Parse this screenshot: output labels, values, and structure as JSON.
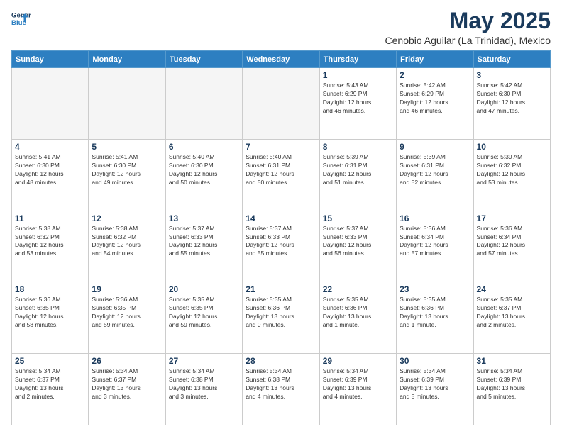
{
  "header": {
    "logo_line1": "General",
    "logo_line2": "Blue",
    "month": "May 2025",
    "location": "Cenobio Aguilar (La Trinidad), Mexico"
  },
  "days_of_week": [
    "Sunday",
    "Monday",
    "Tuesday",
    "Wednesday",
    "Thursday",
    "Friday",
    "Saturday"
  ],
  "weeks": [
    [
      {
        "day": "",
        "info": ""
      },
      {
        "day": "",
        "info": ""
      },
      {
        "day": "",
        "info": ""
      },
      {
        "day": "",
        "info": ""
      },
      {
        "day": "1",
        "info": "Sunrise: 5:43 AM\nSunset: 6:29 PM\nDaylight: 12 hours\nand 46 minutes."
      },
      {
        "day": "2",
        "info": "Sunrise: 5:42 AM\nSunset: 6:29 PM\nDaylight: 12 hours\nand 46 minutes."
      },
      {
        "day": "3",
        "info": "Sunrise: 5:42 AM\nSunset: 6:30 PM\nDaylight: 12 hours\nand 47 minutes."
      }
    ],
    [
      {
        "day": "4",
        "info": "Sunrise: 5:41 AM\nSunset: 6:30 PM\nDaylight: 12 hours\nand 48 minutes."
      },
      {
        "day": "5",
        "info": "Sunrise: 5:41 AM\nSunset: 6:30 PM\nDaylight: 12 hours\nand 49 minutes."
      },
      {
        "day": "6",
        "info": "Sunrise: 5:40 AM\nSunset: 6:30 PM\nDaylight: 12 hours\nand 50 minutes."
      },
      {
        "day": "7",
        "info": "Sunrise: 5:40 AM\nSunset: 6:31 PM\nDaylight: 12 hours\nand 50 minutes."
      },
      {
        "day": "8",
        "info": "Sunrise: 5:39 AM\nSunset: 6:31 PM\nDaylight: 12 hours\nand 51 minutes."
      },
      {
        "day": "9",
        "info": "Sunrise: 5:39 AM\nSunset: 6:31 PM\nDaylight: 12 hours\nand 52 minutes."
      },
      {
        "day": "10",
        "info": "Sunrise: 5:39 AM\nSunset: 6:32 PM\nDaylight: 12 hours\nand 53 minutes."
      }
    ],
    [
      {
        "day": "11",
        "info": "Sunrise: 5:38 AM\nSunset: 6:32 PM\nDaylight: 12 hours\nand 53 minutes."
      },
      {
        "day": "12",
        "info": "Sunrise: 5:38 AM\nSunset: 6:32 PM\nDaylight: 12 hours\nand 54 minutes."
      },
      {
        "day": "13",
        "info": "Sunrise: 5:37 AM\nSunset: 6:33 PM\nDaylight: 12 hours\nand 55 minutes."
      },
      {
        "day": "14",
        "info": "Sunrise: 5:37 AM\nSunset: 6:33 PM\nDaylight: 12 hours\nand 55 minutes."
      },
      {
        "day": "15",
        "info": "Sunrise: 5:37 AM\nSunset: 6:33 PM\nDaylight: 12 hours\nand 56 minutes."
      },
      {
        "day": "16",
        "info": "Sunrise: 5:36 AM\nSunset: 6:34 PM\nDaylight: 12 hours\nand 57 minutes."
      },
      {
        "day": "17",
        "info": "Sunrise: 5:36 AM\nSunset: 6:34 PM\nDaylight: 12 hours\nand 57 minutes."
      }
    ],
    [
      {
        "day": "18",
        "info": "Sunrise: 5:36 AM\nSunset: 6:35 PM\nDaylight: 12 hours\nand 58 minutes."
      },
      {
        "day": "19",
        "info": "Sunrise: 5:36 AM\nSunset: 6:35 PM\nDaylight: 12 hours\nand 59 minutes."
      },
      {
        "day": "20",
        "info": "Sunrise: 5:35 AM\nSunset: 6:35 PM\nDaylight: 12 hours\nand 59 minutes."
      },
      {
        "day": "21",
        "info": "Sunrise: 5:35 AM\nSunset: 6:36 PM\nDaylight: 13 hours\nand 0 minutes."
      },
      {
        "day": "22",
        "info": "Sunrise: 5:35 AM\nSunset: 6:36 PM\nDaylight: 13 hours\nand 1 minute."
      },
      {
        "day": "23",
        "info": "Sunrise: 5:35 AM\nSunset: 6:36 PM\nDaylight: 13 hours\nand 1 minute."
      },
      {
        "day": "24",
        "info": "Sunrise: 5:35 AM\nSunset: 6:37 PM\nDaylight: 13 hours\nand 2 minutes."
      }
    ],
    [
      {
        "day": "25",
        "info": "Sunrise: 5:34 AM\nSunset: 6:37 PM\nDaylight: 13 hours\nand 2 minutes."
      },
      {
        "day": "26",
        "info": "Sunrise: 5:34 AM\nSunset: 6:37 PM\nDaylight: 13 hours\nand 3 minutes."
      },
      {
        "day": "27",
        "info": "Sunrise: 5:34 AM\nSunset: 6:38 PM\nDaylight: 13 hours\nand 3 minutes."
      },
      {
        "day": "28",
        "info": "Sunrise: 5:34 AM\nSunset: 6:38 PM\nDaylight: 13 hours\nand 4 minutes."
      },
      {
        "day": "29",
        "info": "Sunrise: 5:34 AM\nSunset: 6:39 PM\nDaylight: 13 hours\nand 4 minutes."
      },
      {
        "day": "30",
        "info": "Sunrise: 5:34 AM\nSunset: 6:39 PM\nDaylight: 13 hours\nand 5 minutes."
      },
      {
        "day": "31",
        "info": "Sunrise: 5:34 AM\nSunset: 6:39 PM\nDaylight: 13 hours\nand 5 minutes."
      }
    ]
  ]
}
